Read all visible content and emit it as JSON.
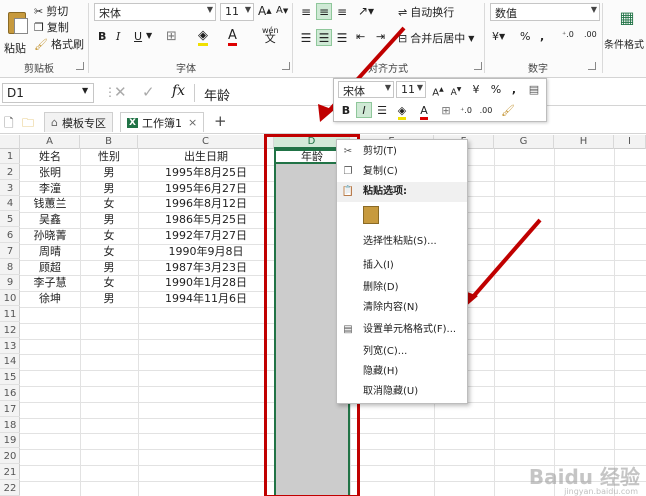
{
  "ribbon": {
    "clipboard": {
      "paste": "粘贴",
      "cut": "剪切",
      "copy": "复制",
      "format_painter": "格式刷",
      "group_label": "剪贴板"
    },
    "font": {
      "family": "宋体",
      "size": "11",
      "grow": "A",
      "shrink": "A",
      "bold": "B",
      "italic": "I",
      "underline": "U",
      "phonetic": "wén",
      "group_label": "字体"
    },
    "alignment": {
      "wrap_text": "自动换行",
      "merge_center": "合并后居中",
      "group_label": "对齐方式"
    },
    "number": {
      "format": "数值",
      "currency": "¥",
      "percent": "%",
      "comma": ",",
      "group_label": "数字"
    },
    "styles": {
      "conditional": "条件格式"
    }
  },
  "formula_bar": {
    "name_box": "D1",
    "fx": "fx",
    "value": "年龄"
  },
  "tabs": {
    "template": "模板专区",
    "workbook": "工作簿1",
    "add": "+"
  },
  "columns": [
    "A",
    "B",
    "C",
    "D",
    "E",
    "F",
    "G",
    "H",
    "I"
  ],
  "rows": [
    "1",
    "2",
    "3",
    "4",
    "5",
    "6",
    "7",
    "8",
    "9",
    "10",
    "11",
    "12",
    "13",
    "14",
    "15",
    "16",
    "17",
    "18",
    "19",
    "20",
    "21",
    "22"
  ],
  "table": {
    "headers": [
      "姓名",
      "性别",
      "出生日期",
      "年龄"
    ],
    "data": [
      [
        "张明",
        "男",
        "1995年8月25日"
      ],
      [
        "李潼",
        "男",
        "1995年6月27日"
      ],
      [
        "钱蕙兰",
        "女",
        "1996年8月12日"
      ],
      [
        "吴鑫",
        "男",
        "1986年5月25日"
      ],
      [
        "孙晓菁",
        "女",
        "1992年7月27日"
      ],
      [
        "周晴",
        "女",
        "1990年9月8日"
      ],
      [
        "顾超",
        "男",
        "1987年3月23日"
      ],
      [
        "李子慧",
        "女",
        "1990年1月28日"
      ],
      [
        "徐坤",
        "男",
        "1994年11月6日"
      ]
    ]
  },
  "mini_toolbar": {
    "font": "宋体",
    "size": "11",
    "currency": "¥",
    "percent": "%",
    "comma": ",",
    "bold": "B",
    "italic": "I"
  },
  "context_menu": {
    "items": [
      "剪切(T)",
      "复制(C)",
      "粘贴选项:",
      "",
      "选择性粘贴(S)...",
      "插入(I)",
      "删除(D)",
      "清除内容(N)",
      "设置单元格格式(F)...",
      "列宽(C)...",
      "隐藏(H)",
      "取消隐藏(U)"
    ]
  },
  "watermark": {
    "logo": "Baidu 经验",
    "url": "jingyan.baidu.com"
  },
  "colors": {
    "excel_green": "#217346",
    "annotation_red": "#c00000"
  }
}
